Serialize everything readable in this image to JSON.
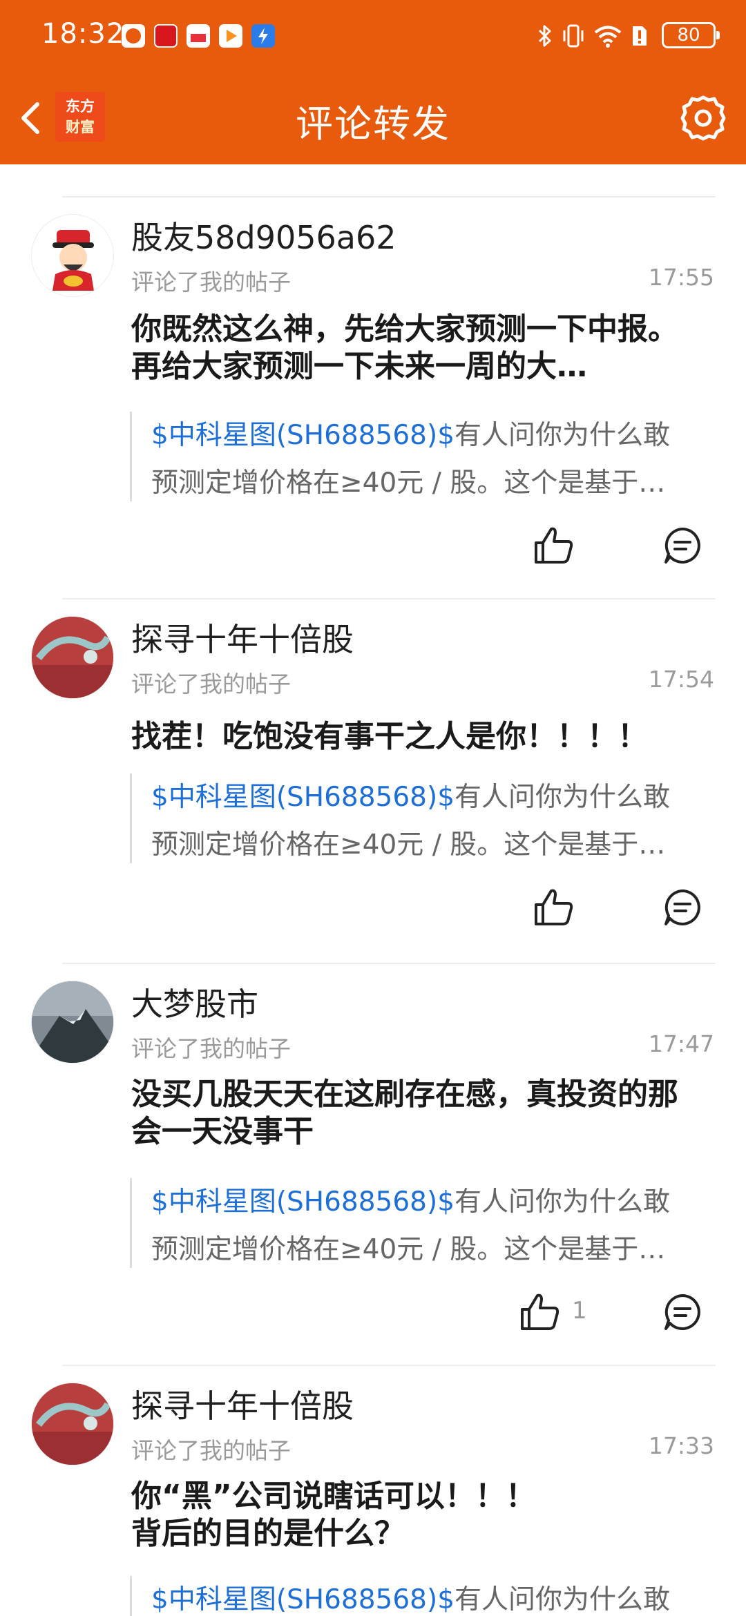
{
  "status_bar": {
    "time": "18:32",
    "battery": "80",
    "app_icons": [
      {
        "name": "app-icon-1",
        "color": "#ffffff"
      },
      {
        "name": "app-icon-2",
        "color": "#d8161b"
      },
      {
        "name": "app-icon-3",
        "color": "#ffffff"
      },
      {
        "name": "app-icon-4",
        "color": "#f7931e"
      },
      {
        "name": "app-icon-5",
        "color": "#2b7be9"
      }
    ]
  },
  "nav": {
    "logo_line1": "东方",
    "logo_line2": "财富",
    "title": "评论转发"
  },
  "colors": {
    "header": "#e85a0c",
    "stock_link": "#1d6fd6",
    "secondary_text": "#9a9a9a"
  },
  "comments": [
    {
      "username": "股友58d9056a62",
      "action": "评论了我的帖子",
      "time": "17:55",
      "text": "你既然这么神，先给大家预测一下中报。再给大家预测一下未来一周的大…",
      "quote_stock": "$中科星图(SH688568)$",
      "quote_rest": "有人问你为什么敢",
      "quote_line2": "预测定增价格在≥40元 / 股。这个是基于…",
      "likes": ""
    },
    {
      "username": "探寻十年十倍股",
      "action": "评论了我的帖子",
      "time": "17:54",
      "text": "找茬！吃饱没有事干之人是你！！！！",
      "quote_stock": "$中科星图(SH688568)$",
      "quote_rest": "有人问你为什么敢",
      "quote_line2": "预测定增价格在≥40元 / 股。这个是基于…",
      "likes": ""
    },
    {
      "username": "大梦股市",
      "action": "评论了我的帖子",
      "time": "17:47",
      "text": "没买几股天天在这刷存在感，真投资的那会一天没事干",
      "quote_stock": "$中科星图(SH688568)$",
      "quote_rest": "有人问你为什么敢",
      "quote_line2": "预测定增价格在≥40元 / 股。这个是基于…",
      "likes": "1"
    },
    {
      "username": "探寻十年十倍股",
      "action": "评论了我的帖子",
      "time": "17:33",
      "text": "你“黑”公司说瞎话可以！！！\n背后的目的是什么？",
      "quote_stock": "$中科星图(SH688568)$",
      "quote_rest": "有人问你为什么敢",
      "quote_line2": "",
      "likes": ""
    }
  ]
}
